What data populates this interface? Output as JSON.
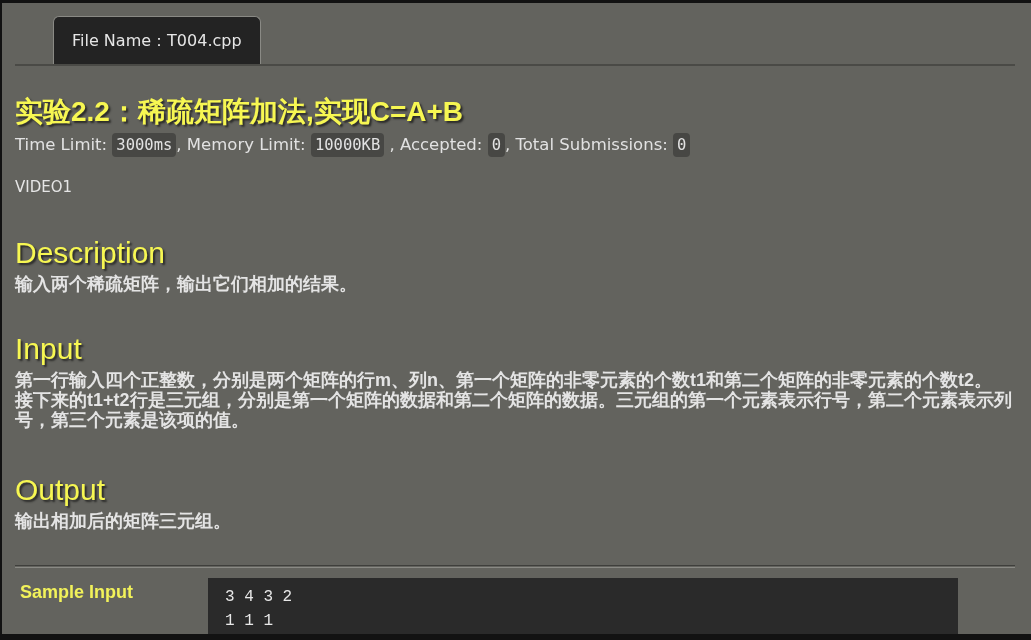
{
  "tabs": [
    {
      "label": "File Name：T004.cpp",
      "selected": true
    }
  ],
  "problem": {
    "title": "实验2.2：稀疏矩阵加法,实现C=A+B",
    "meta": [
      {
        "label": "Time Limit: ",
        "value": "3000ms"
      },
      {
        "label": ", Memory Limit: ",
        "value": "10000KB"
      },
      {
        "label": " , Accepted: ",
        "value": "0"
      },
      {
        "label": ", Total Submissions: ",
        "value": "0"
      }
    ],
    "note": "VIDEO1",
    "sections": [
      {
        "heading": "Description",
        "paragraphs": [
          "输入两个稀疏矩阵，输出它们相加的结果。"
        ]
      },
      {
        "heading": "Input",
        "paragraphs": [
          "第一行输入四个正整数，分别是两个矩阵的行m、列n、第一个矩阵的非零元素的个数t1和第二个矩阵的非零元素的个数t2。",
          "接下来的t1+t2行是三元组，分别是第一个矩阵的数据和第二个矩阵的数据。三元组的第一个元素表示行号，第二个元素表示列号，第三个元素是该项的值。"
        ]
      },
      {
        "heading": "Output",
        "paragraphs": [
          "输出相加后的矩阵三元组。"
        ]
      }
    ]
  },
  "samples": [
    {
      "label": "Sample Input",
      "lines": [
        "3 4 3 2",
        "1 1 1"
      ]
    }
  ]
}
